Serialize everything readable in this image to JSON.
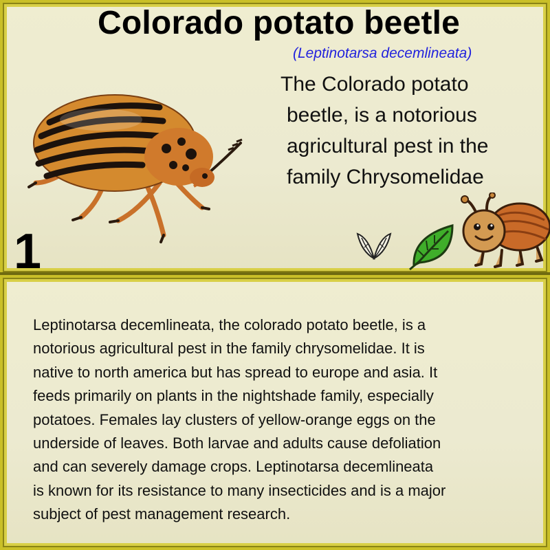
{
  "card": {
    "title": "Colorado potato beetle",
    "scientific_name": "(Leptinotarsa decemlineata)",
    "summary_lines": [
      "The Colorado potato",
      " beetle, is a notorious",
      " agricultural pest in the",
      " family Chrysomelidae"
    ],
    "number": "1",
    "body_lines": [
      "Leptinotarsa decemlineata, the colorado potato beetle, is a",
      "notorious agricultural pest in the family chrysomelidae. It is",
      "native to north america but has spread to europe and asia. It",
      "feeds primarily on plants in the nightshade family, especially",
      "potatoes. Females lay clusters of yellow-orange eggs on the",
      "underside of leaves. Both larvae and adults cause defoliation",
      "and can severely damage crops. Leptinotarsa decemlineata",
      "is known for its resistance to many insecticides and is a major",
      "subject of pest management research."
    ]
  },
  "icons": {
    "wings": "insect-wings-icon",
    "leaf": "leaf-icon",
    "bug": "cartoon-beetle-icon"
  },
  "colors": {
    "frame": "#c9bf27",
    "frame_dark": "#6f6a10",
    "background": "#ecead0",
    "scientific_name": "#2222dd",
    "leaf": "#3fae2a",
    "beetle_orange": "#d9852e"
  }
}
